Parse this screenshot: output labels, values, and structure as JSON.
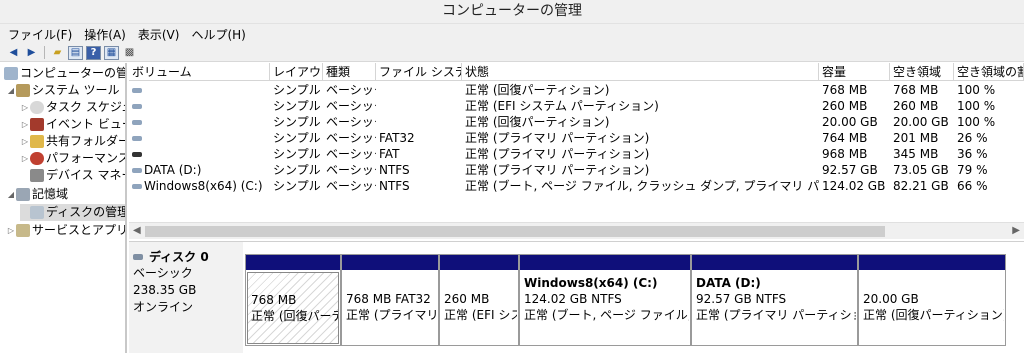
{
  "window": {
    "title": "コンピューターの管理"
  },
  "menu": [
    "ファイル(F)",
    "操作(A)",
    "表示(V)",
    "ヘルプ(H)"
  ],
  "tree": [
    {
      "label": "コンピューターの管理",
      "indent": 0,
      "exp": ""
    },
    {
      "label": "システム ツール",
      "indent": 1,
      "exp": "◢"
    },
    {
      "label": "タスク スケジューラ",
      "indent": 2,
      "exp": "▷"
    },
    {
      "label": "イベント ビューアー",
      "indent": 2,
      "exp": "▷"
    },
    {
      "label": "共有フォルダー",
      "indent": 2,
      "exp": "▷"
    },
    {
      "label": "パフォーマンス",
      "indent": 2,
      "exp": "▷"
    },
    {
      "label": "デバイス マネージャー",
      "indent": 2,
      "exp": ""
    },
    {
      "label": "記憶域",
      "indent": 1,
      "exp": "◢"
    },
    {
      "label": "ディスクの管理",
      "indent": 2,
      "exp": "",
      "selected": true
    },
    {
      "label": "サービスとアプリケーション",
      "indent": 1,
      "exp": "▷"
    }
  ],
  "volumes": {
    "columns": [
      "ボリューム",
      "レイアウト",
      "種類",
      "ファイル システム",
      "状態",
      "容量",
      "空き領域",
      "空き領域の割合"
    ],
    "rows": [
      [
        "",
        "シンプル",
        "ベーシック",
        "",
        "正常 (回復パーティション)",
        "768 MB",
        "768 MB",
        "100 %"
      ],
      [
        "",
        "シンプル",
        "ベーシック",
        "",
        "正常 (EFI システム パーティション)",
        "260 MB",
        "260 MB",
        "100 %"
      ],
      [
        "",
        "シンプル",
        "ベーシック",
        "",
        "正常 (回復パーティション)",
        "20.00 GB",
        "20.00 GB",
        "100 %"
      ],
      [
        "",
        "シンプル",
        "ベーシック",
        "FAT32",
        "正常 (プライマリ パーティション)",
        "764 MB",
        "201 MB",
        "26 %"
      ],
      [
        "",
        "シンプル",
        "ベーシック",
        "FAT",
        "正常 (プライマリ パーティション)",
        "968 MB",
        "345 MB",
        "36 %"
      ],
      [
        "DATA (D:)",
        "シンプル",
        "ベーシック",
        "NTFS",
        "正常 (プライマリ パーティション)",
        "92.57 GB",
        "73.05 GB",
        "79 %"
      ],
      [
        "Windows8(x64) (C:)",
        "シンプル",
        "ベーシック",
        "NTFS",
        "正常 (ブート, ページ ファイル, クラッシュ ダンプ, プライマリ パーティション)",
        "124.02 GB",
        "82.21 GB",
        "66 %"
      ]
    ]
  },
  "disk": {
    "name": "ディスク 0",
    "type": "ベーシック",
    "size": "238.35 GB",
    "status": "オンライン",
    "partitions": [
      {
        "title": "",
        "size": "768 MB",
        "status": "正常 (回復パーティション)",
        "hatched": true
      },
      {
        "title": "",
        "size": "768 MB FAT32",
        "status": "正常 (プライマリ パーティション)"
      },
      {
        "title": "",
        "size": "260 MB",
        "status": "正常 (EFI システム パーティション)"
      },
      {
        "title": "Windows8(x64)  (C:)",
        "size": "124.02 GB NTFS",
        "status": "正常 (ブート, ページ ファイル, クラッシュ ダンプ, プライマリ パーティション)"
      },
      {
        "title": "DATA  (D:)",
        "size": "92.57 GB NTFS",
        "status": "正常 (プライマリ パーティション)"
      },
      {
        "title": "",
        "size": "20.00 GB",
        "status": "正常 (回復パーティション)"
      }
    ]
  }
}
